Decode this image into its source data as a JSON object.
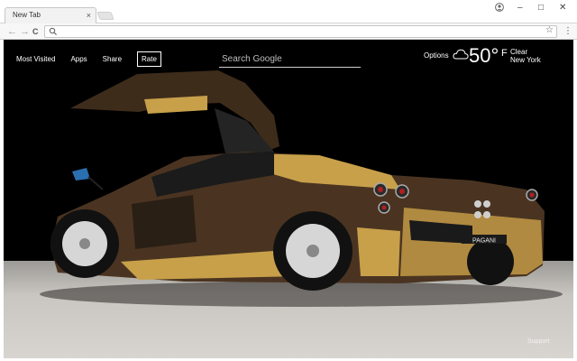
{
  "browser": {
    "tab_title": "New Tab",
    "tab_close": "×",
    "window_controls": {
      "minimize": "–",
      "maximize": "□",
      "close": "✕"
    },
    "icons": {
      "profile": "person-icon",
      "back": "arrow-left-icon",
      "forward": "arrow-right-icon",
      "reload": "reload-icon",
      "omnibox_search": "search-icon",
      "bookmark": "star-icon",
      "menu": "vertical-dots-icon"
    },
    "address": "",
    "glyphs": {
      "back": "←",
      "forward": "→",
      "reload": "C",
      "star": "☆",
      "menu": "⋮"
    }
  },
  "page": {
    "nav": {
      "most_visited": "Most Visited",
      "apps": "Apps",
      "share": "Share",
      "rate": "Rate"
    },
    "search": {
      "placeholder": "Search Google"
    },
    "options": "Options",
    "weather": {
      "temperature": "50°",
      "unit": "F",
      "condition": "Clear",
      "location": "New York",
      "icon": "cloud-icon"
    },
    "support": "Support",
    "background": {
      "subject": "car",
      "badge": "PAGANI",
      "colors": {
        "body_brown": "#4a3421",
        "body_gold": "#c8a04a",
        "sky": "#000000",
        "floor": "#c9c6c1"
      }
    }
  }
}
